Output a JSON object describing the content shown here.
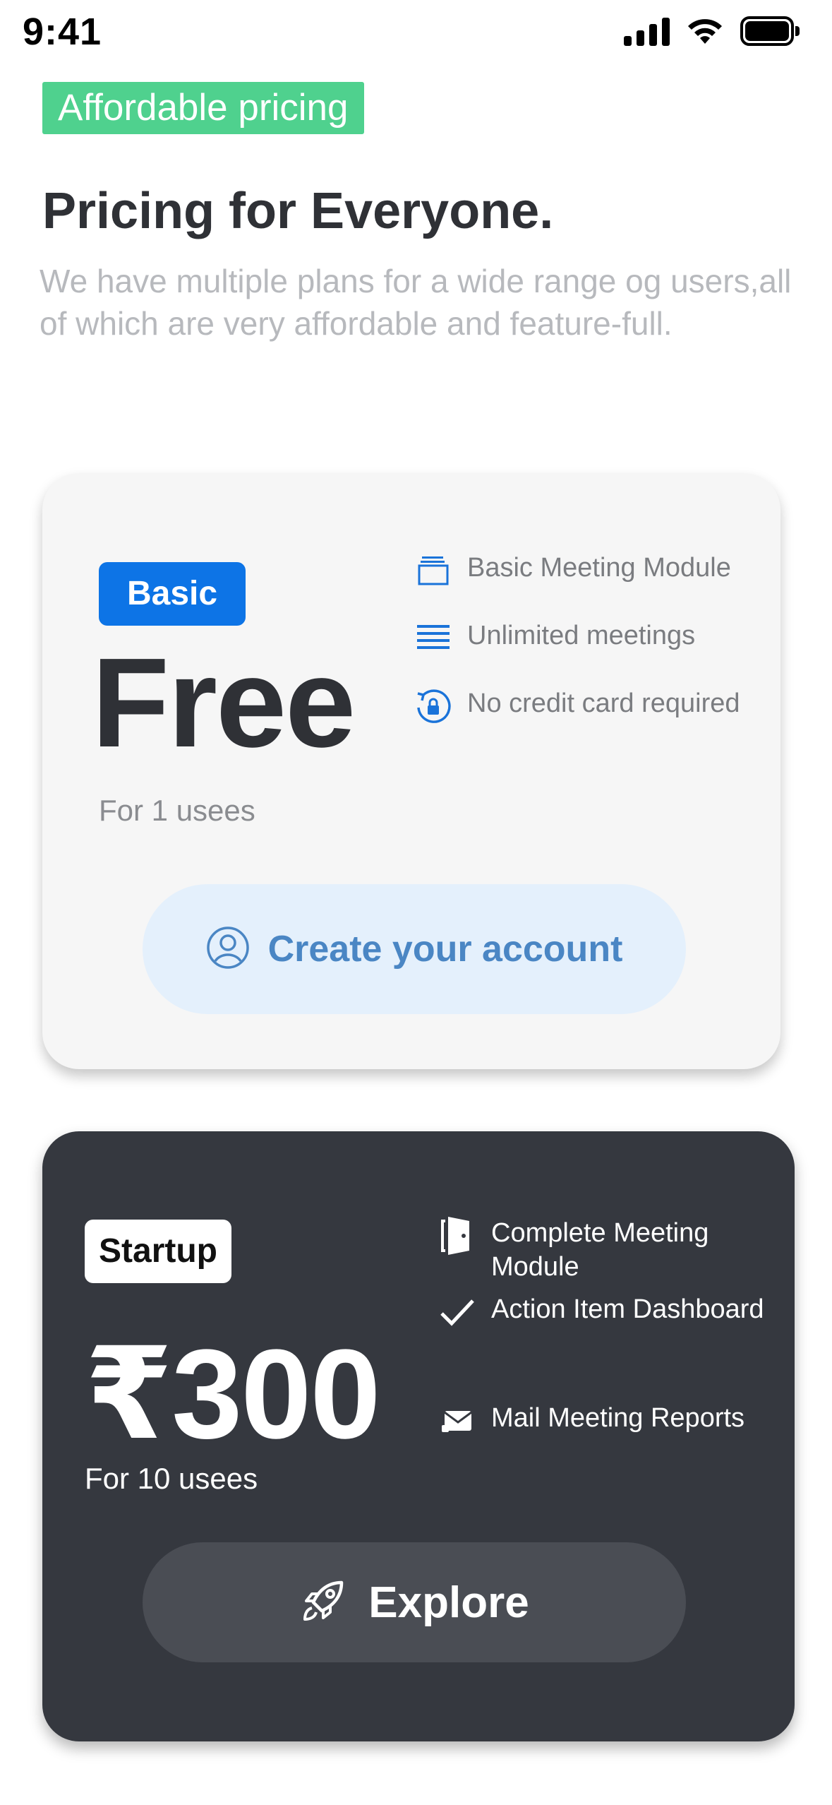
{
  "status_bar": {
    "time": "9:41"
  },
  "header": {
    "eyebrow": "Affordable pricing",
    "title": "Pricing for Everyone.",
    "subtitle": "We have multiple plans for a wide range og users,all of which are very affordable and feature-full."
  },
  "colors": {
    "accent_green": "#4fd18e",
    "accent_blue": "#0d74e6",
    "dark_card": "#35383f",
    "light_card": "#f6f6f6"
  },
  "plans": [
    {
      "badge": "Basic",
      "price": "Free",
      "users": "For 1 usees",
      "features": [
        {
          "icon": "stack-icon",
          "label": "Basic Meeting Module"
        },
        {
          "icon": "lines-icon",
          "label": "Unlimited meetings"
        },
        {
          "icon": "lock-reset-icon",
          "label": "No credit card required"
        }
      ],
      "cta": {
        "icon": "user-circle-icon",
        "label": "Create your account"
      }
    },
    {
      "badge": "Startup",
      "price": "₹300",
      "users": "For 10 usees",
      "features": [
        {
          "icon": "door-icon",
          "label": "Complete Meeting Module"
        },
        {
          "icon": "check-icon",
          "label": "Action Item Dashboard"
        },
        {
          "icon": "mail-icon",
          "label": "Mail Meeting  Reports"
        }
      ],
      "cta": {
        "icon": "rocket-icon",
        "label": "Explore"
      }
    }
  ]
}
